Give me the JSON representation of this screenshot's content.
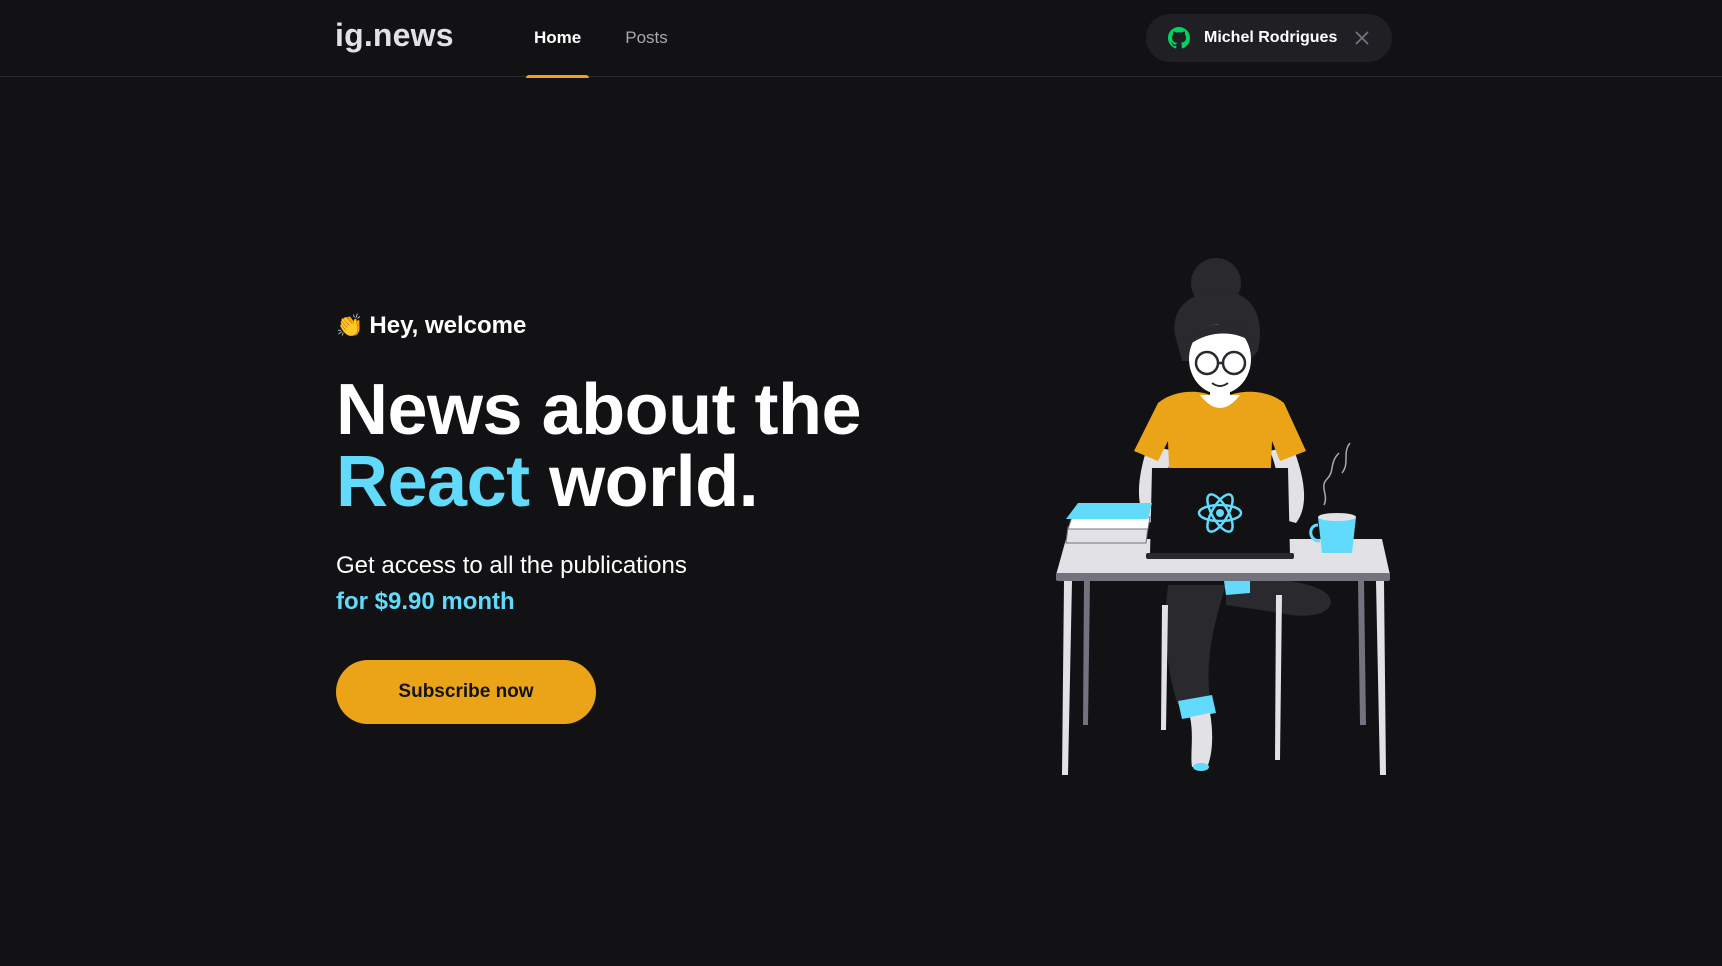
{
  "header": {
    "logo": "ig.news",
    "nav": [
      {
        "label": "Home",
        "active": true
      },
      {
        "label": "Posts",
        "active": false
      }
    ],
    "user": {
      "name": "Michel Rodrigues",
      "icon": "github-icon",
      "icon_color": "#04d361"
    }
  },
  "hero": {
    "greeting_icon": "👏",
    "greeting": "Hey, welcome",
    "headline_line1": "News about the",
    "headline_accent": "React",
    "headline_rest": "world.",
    "subtitle": "Get access to all the publications",
    "price": "for $9.90 month",
    "cta": "Subscribe now"
  },
  "colors": {
    "background": "#121214",
    "accent_yellow": "#eba417",
    "accent_cyan": "#61dafb",
    "header_button_bg": "#202024"
  }
}
